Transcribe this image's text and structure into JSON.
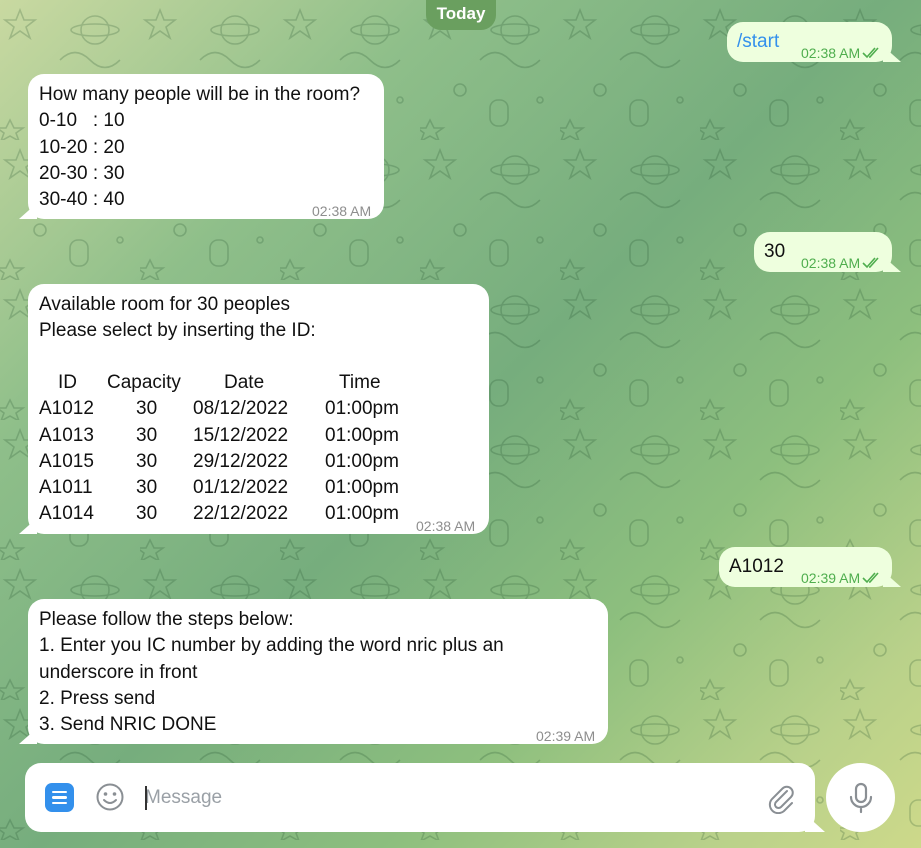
{
  "date_separator": "Today",
  "messages": [
    {
      "direction": "out",
      "text": "/start",
      "time": "02:38 AM",
      "is_command": true
    },
    {
      "direction": "in",
      "text": "How many people will be in the room?\n0-10   : 10\n10-20 : 20\n20-30 : 30\n30-40 : 40",
      "time": "02:38 AM"
    },
    {
      "direction": "out",
      "text": "30",
      "time": "02:38 AM"
    },
    {
      "direction": "in",
      "time": "02:38 AM",
      "intro": "Available room for 30 peoples\nPlease select by inserting the ID:",
      "table": {
        "headers": [
          "ID",
          "Capacity",
          "Date",
          "Time"
        ],
        "rows": [
          [
            "A1012",
            "30",
            "08/12/2022",
            "01:00pm"
          ],
          [
            "A1013",
            "30",
            "15/12/2022",
            "01:00pm"
          ],
          [
            "A1015",
            "30",
            "29/12/2022",
            "01:00pm"
          ],
          [
            "A1011",
            "30",
            "01/12/2022",
            "01:00pm"
          ],
          [
            "A1014",
            "30",
            "22/12/2022",
            "01:00pm"
          ]
        ]
      }
    },
    {
      "direction": "out",
      "text": "A1012",
      "time": "02:39 AM"
    },
    {
      "direction": "in",
      "text": "Please follow the steps below:\n1. Enter you IC number by adding the word nric plus an\nunderscore in front\n2. Press send\n3. Send NRIC DONE",
      "time": "02:39 AM"
    }
  ],
  "composer": {
    "placeholder": "Message"
  },
  "colors": {
    "accent": "#3390ec",
    "outgoing_bubble": "#eeffde",
    "outgoing_meta": "#4fae4e",
    "date_pill": "#6a9f5f"
  },
  "icons": [
    "menu-icon",
    "emoji-icon",
    "attach-icon",
    "mic-icon",
    "double-check-icon"
  ]
}
